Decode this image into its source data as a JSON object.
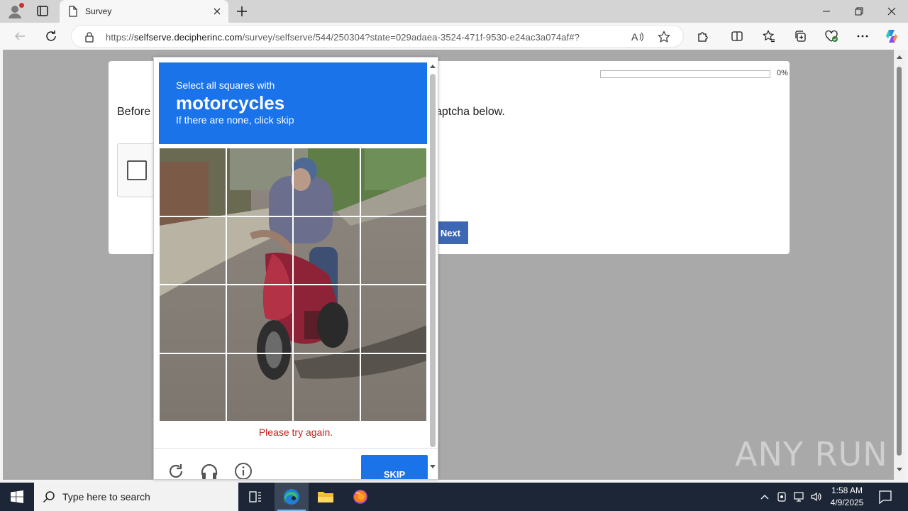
{
  "browser": {
    "tab_title": "Survey",
    "url_prefix": "https://",
    "url_host": "selfserve.decipherinc.com",
    "url_path": "/survey/selfserve/544/250304?state=029adaea-3524-471f-9530-e24ac3a074af#?"
  },
  "survey": {
    "progress_label": "0%",
    "progress_percent": 0,
    "prompt_left": "Before",
    "prompt_right": "aptcha below.",
    "next_label": "Next"
  },
  "captcha": {
    "instruction": "Select all squares with",
    "target": "motorcycles",
    "hint": "If there are none, click skip",
    "error": "Please try again.",
    "skip_label": "SKIP",
    "grid_rows": 4,
    "grid_cols": 4,
    "header_color": "#1a73e8"
  },
  "watermark": {
    "text": "ANY RUN"
  },
  "taskbar": {
    "search_placeholder": "Type here to search",
    "time": "1:58 AM",
    "date": "4/9/2025"
  },
  "icons": [
    "profile-icon",
    "tab-actions-icon",
    "document-icon",
    "close-icon",
    "new-tab-icon",
    "minimize-icon",
    "restore-icon",
    "back-icon",
    "refresh-icon",
    "lock-icon",
    "read-aloud-icon",
    "favorite-icon",
    "extensions-icon",
    "split-screen-icon",
    "favorites-icon",
    "collections-icon",
    "browser-essentials-icon",
    "more-icon",
    "copilot-icon",
    "reload-challenge-icon",
    "audio-challenge-icon",
    "info-icon",
    "windows-start-icon",
    "search-icon",
    "task-view-icon",
    "edge-icon",
    "file-explorer-icon",
    "firefox-icon",
    "notification-icon"
  ]
}
